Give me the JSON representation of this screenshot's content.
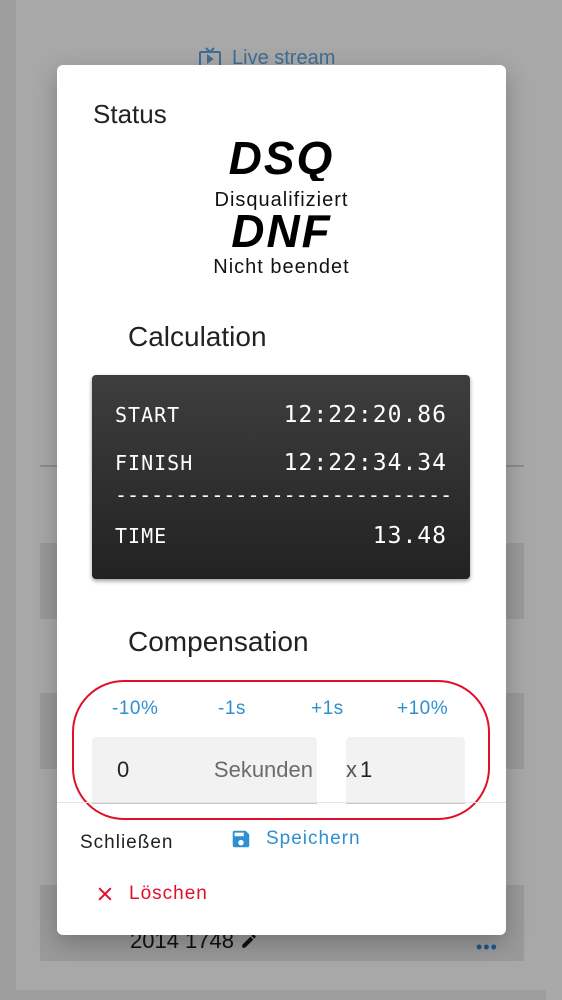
{
  "background": {
    "live_stream_label": "Live stream",
    "row_text": "2014 1748",
    "more_icon": "more-horizontal-icon"
  },
  "dialog": {
    "title": "Status",
    "statuses": [
      {
        "code": "DSQ",
        "description": "Disqualifiziert"
      },
      {
        "code": "DNF",
        "description": "Nicht beendet"
      }
    ],
    "calculation": {
      "title": "Calculation",
      "start_label": "START",
      "start_value": "12:22:20.86",
      "finish_label": "FINISH",
      "finish_value": "12:22:34.34",
      "separator": "----------------------------",
      "time_label": "TIME",
      "time_value": "13.48"
    },
    "compensation": {
      "title": "Compensation",
      "buttons": [
        "-10%",
        "-1s",
        "+1s",
        "+10%"
      ],
      "seconds_value": "0",
      "seconds_suffix": "Sekunden",
      "multiplier_prefix": "x",
      "multiplier_value": "1"
    },
    "actions": {
      "close_label": "Schließen",
      "save_label": "Speichern",
      "delete_label": "Löschen"
    }
  },
  "colors": {
    "accent": "#2f8fd0",
    "danger": "#e0102a",
    "annotation": "#e0102a"
  }
}
